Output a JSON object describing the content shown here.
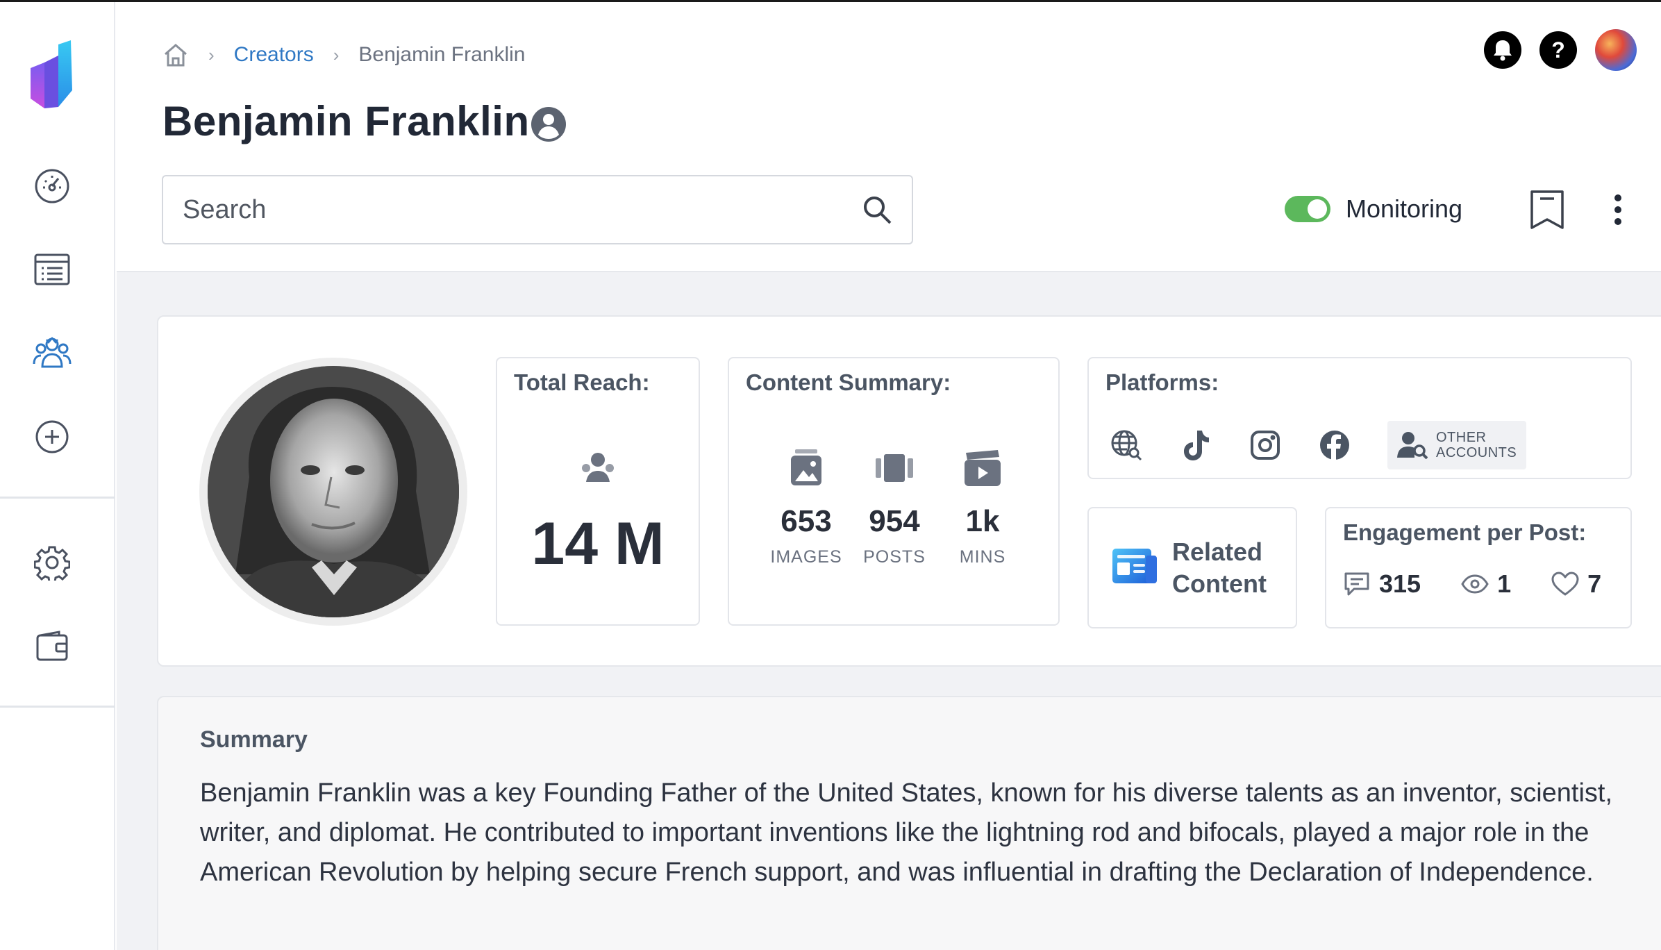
{
  "breadcrumb": {
    "home_icon": "home-icon",
    "separator": "›",
    "creators": "Creators",
    "current": "Benjamin Franklin"
  },
  "header": {
    "title": "Benjamin Franklin",
    "title_icon": "user-circle-icon"
  },
  "search": {
    "placeholder": "Search",
    "value": ""
  },
  "monitoring": {
    "label": "Monitoring",
    "enabled": true,
    "toggle_color": "#5cb85c"
  },
  "sidebar": {
    "items": [
      {
        "icon": "dashboard-gauge-icon"
      },
      {
        "icon": "list-icon"
      },
      {
        "icon": "creators-group-icon",
        "active": true
      },
      {
        "icon": "add-circle-icon"
      },
      {
        "icon": "gear-icon"
      },
      {
        "icon": "wallet-icon"
      }
    ],
    "active_color": "#2f78c4"
  },
  "total_reach": {
    "title": "Total Reach:",
    "value": "14 M"
  },
  "content_summary": {
    "title": "Content Summary:",
    "items": [
      {
        "value": "653",
        "unit": "IMAGES",
        "icon": "images-icon"
      },
      {
        "value": "954",
        "unit": "POSTS",
        "icon": "posts-icon"
      },
      {
        "value": "1k",
        "unit": "MINS",
        "icon": "video-icon"
      }
    ]
  },
  "platforms": {
    "title": "Platforms:",
    "icons": [
      "web-search-icon",
      "tiktok-icon",
      "instagram-icon",
      "facebook-icon"
    ],
    "other_line1": "OTHER",
    "other_line2": "ACCOUNTS"
  },
  "related": {
    "line1": "Related",
    "line2": "Content"
  },
  "engagement": {
    "title": "Engagement per Post:",
    "comments": "315",
    "views": "1",
    "likes": "7"
  },
  "summary": {
    "title": "Summary",
    "text": "Benjamin Franklin was a key Founding Father of the United States, known for his diverse talents as an inventor, scientist, writer, and diplomat. He contributed to important inventions like the lightning rod and bifocals, played a major role in the American Revolution by helping secure French support, and was influential in drafting the Declaration of Independence."
  }
}
